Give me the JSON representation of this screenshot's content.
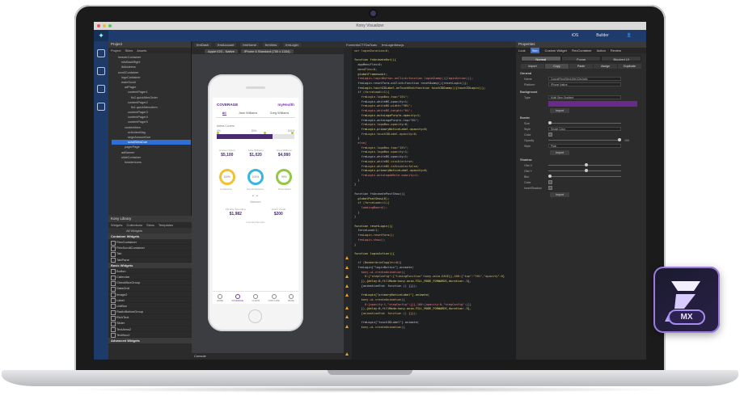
{
  "window": {
    "title": "Kony Visualizer"
  },
  "toolbar": {
    "item1": "iOS",
    "item2": "Builder"
  },
  "project_panel": {
    "title": "Project",
    "tabs": [
      "Project",
      "Skins",
      "Assets"
    ],
    "tree": [
      "headerContainer",
      "infoBackRight",
      "lblAddress",
      "scrollContainer",
      "logoContainer",
      "mainScroll",
      "adPager",
      "contentPager1",
      "flx2.quickMenOrder",
      "contentPager2",
      "flx1.quickMenuItem",
      "contentPager3",
      "contentPager4",
      "contentPager5",
      "contentItem",
      "scNoticeMsg",
      "segnAmountDue",
      "scrollViewDue",
      "pagerPage",
      "adBanner",
      "slideContainer",
      "headerIcons"
    ]
  },
  "library": {
    "title": "Kony Library",
    "tabs": [
      "Widgets",
      "Collections",
      "Skins",
      "Templates"
    ],
    "filter": "All Widgets",
    "section1": "Container Widgets",
    "container_items": [
      "FlexContainer",
      "FlexScrollContainer",
      "Tab",
      "TabPane"
    ],
    "section2": "Basic Widgets",
    "basic_items": [
      "Button",
      "Calendar",
      "CheckBoxGroup",
      "DataGrid",
      "Image2",
      "Label",
      "ListBox",
      "RadioButtonGroup",
      "RichText",
      "Slider",
      "TextArea2",
      "TextBox2"
    ],
    "section3": "Advanced Widgets"
  },
  "canvas": {
    "tabs": [
      "frmDash",
      "frmAccount",
      "frmHome",
      "frmView",
      "frmLogin"
    ],
    "device": "Apple iOS - Native",
    "model": "iPhone 6 Standard (750 x 1334)",
    "console": "Console"
  },
  "phone": {
    "brand": "COVERAGE",
    "brand_right": "myHealth",
    "segments": [
      "All",
      "Jane Williams",
      "Greg Williams"
    ],
    "coverage_label": "Aetna Covers",
    "scale": [
      "0%",
      "80%",
      "100%"
    ],
    "coverage_fraction": 0.72,
    "amounts": [
      {
        "label": "Amount Spent",
        "value": "$5,100"
      },
      {
        "label": "Jane Williams",
        "value": "$1,020"
      },
      {
        "label": "Greg Williams",
        "value": "$4,080"
      }
    ],
    "rings": [
      {
        "value": "100%",
        "label": "In-Network"
      },
      {
        "value": "100%",
        "label": "Out-Of-Network"
      },
      {
        "value": "90%",
        "label": "Prescription"
      }
    ],
    "pager": "• •",
    "balance_label": "Balances",
    "spending": [
      {
        "label": "Flexible Spending",
        "value": "$1,982"
      },
      {
        "label": "Vision Credit",
        "value": "$200"
      }
    ],
    "included": "Included Benefits",
    "nav": [
      "HOME",
      "COVERAGE",
      "CLAIMS",
      "FIND CARE",
      "MORE"
    ]
  },
  "code": {
    "tabs": [
      "FormInfoCTTDaTcalc",
      "frmLoginNew.js"
    ],
    "lines": [
      "var loginDuration=0;",
      "",
      "function fnAnimateOut(){",
      "  appMenuFlex=0;",
      "  menuFlex=0;",
      "  globalFrameswait;",
      "  frmLogin.loginButton.onClick=function loginDummy(){loginAction()};",
      "  frmLogin.resetForm.onClick=function resetDummy(){resetLogin()};",
      "  frmLogin.touchIDLabel.onTouchEnd=function touchIDDummy(){touchIDLogin()};",
      "  if (forceLoad==1){",
      "    frmLogin.logoBox.top=\"15%\";",
      "    frmLogin.whiteBG.opacity=1;",
      "    frmLogin.whiteBG.width=\"90%\";",
      "    frmLogin.whiteBG.height=\"0%\";",
      "    frmLogin.autoLogoPurple.opacity=1;",
      "    frmLogin.autoLogoPurple.top=\"0%\";",
      "    frmLogin.logoBox.opacity=0;",
      "    frmLogin.primaryNoticeLabel.opacity=0;",
      "    frmLogin.touchIDLabel.opacity=0;",
      "  }",
      "  else{",
      "    frmLogin.logoBox.top=\"15%\";",
      "    frmLogin.logoBox.opacity=1;",
      "    frmLogin.whiteBG.opacity=1;",
      "    frmLogin.whiteBG.visible=true;",
      "    frmLogin.whiteBG.isVisible=false;",
      "    frmLogin.primaryNoticeLabel.opacity=0;",
      "    frmLogin.autoLogoWhite.opacity=1;",
      "  }",
      "}",
      "",
      "function fnAnimatePostShow(){",
      "  globalPostShow(0);",
      "  if (forceLoad==1){",
      "    loadingBoard();",
      "  }",
      "}",
      "",
      "function resetLogin(){",
      "  forceLoad=1;",
      "  frmLogin.resetForm();",
      "  frmLogin.show();",
      "}",
      "",
      "function loginAction(){",
      "",
      "  if (NumberAnimToggle==0){",
      "  frmLogin[\"loginButton\"].animate(",
      "    kony.ui.createAnimation({",
      "      0:{\"stepConfig\":{\"timingFunction\":kony.anim.EASE}},100:{\"top\":\"70%\",\"opacity\":0}",
      "    }),{delay:0,fillMode:kony.anim.FILL_MODE_FORWARDS,duration:.3},",
      "    {animationEnd: function () {}});",
      "",
      "    frmLogin[\"primaryNoticeLabel\"].animate(",
      "    kony.ui.createAnimation({",
      "      0:{opacity:1,\"stepConfig\":{}},100:{opacity:0,\"stepConfig\":{}}",
      "    }),{delay:0,fillMode:kony.anim.FILL_MODE_FORWARDS,duration:.3},",
      "    {animationEnd: function () {}});",
      "",
      "    frmLogin[\"touchIDLabel\"].animate(",
      "    kony.ui.createAnimation({"
    ]
  },
  "properties": {
    "title": "Properties",
    "tabs": [
      "Look",
      "Skin",
      "Custom Widget",
      "FlexContainer",
      "Action",
      "Review"
    ],
    "states": [
      "Normal",
      "Focus",
      "Blocked UI"
    ],
    "actions": [
      "Import",
      "Copy",
      "Paste",
      "Assign",
      "Duplicate"
    ],
    "sec_general": "General",
    "name_label": "Name",
    "name_value": "CopyslFboxSkin149e1Cfe2a4b",
    "platform_label": "Platform",
    "platform_value": "iPhone Native",
    "sec_background": "Background",
    "type_label": "Type",
    "type_value": "Multi Step Gradient",
    "import": "Import",
    "sec_border": "Border",
    "size_label": "Size",
    "style_label": "Style",
    "style_value": "Single Color",
    "color_label": "Color",
    "opacity_label": "Opacity",
    "opacity_value": "100",
    "radius_label": "Style",
    "radius_value": "Plain",
    "sec_shadow": "Shadow",
    "offx_label": "Ofst X",
    "offy_label": "Ofst Y",
    "blur_label": "Blur",
    "scolor_label": "Color",
    "inset_label": "Inset/Shadow"
  },
  "badge": {
    "text": "MX"
  }
}
